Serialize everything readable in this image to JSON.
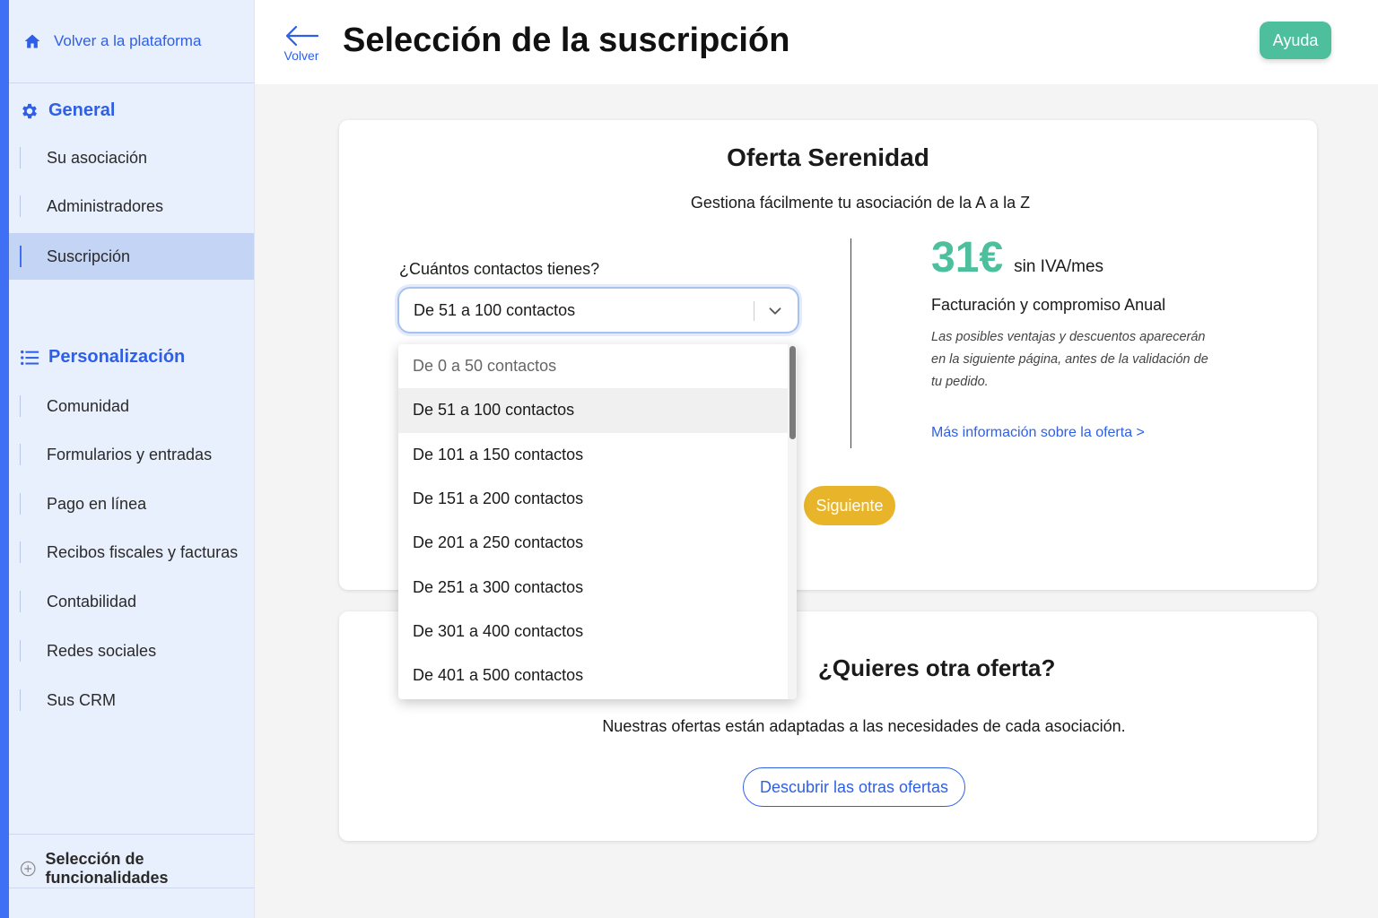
{
  "sidebar": {
    "back_label": "Volver a la plataforma",
    "general_label": "General",
    "general_items": [
      "Su asociación",
      "Administradores",
      "Suscripción"
    ],
    "personalizacion_label": "Personalización",
    "personalizacion_items": [
      "Comunidad",
      "Formularios y entradas",
      "Pago en línea",
      "Recibos fiscales y facturas",
      "Contabilidad",
      "Redes sociales",
      "Sus CRM"
    ],
    "bottom_label": "Selección de funcionalidades",
    "active_item": "Suscripción"
  },
  "header": {
    "back_label": "Volver",
    "title": "Selección de la suscripción",
    "help_label": "Ayuda"
  },
  "offer": {
    "title": "Oferta Serenidad",
    "subtitle": "Gestiona fácilmente tu asociación de la A a la Z",
    "question": "¿Cuántos contactos tienes?",
    "selected_value": "De 51 a 100 contactos",
    "price": "31€",
    "price_unit": "sin IVA/mes",
    "billing": "Facturación y compromiso Anual",
    "note": "Las posibles ventajas y descuentos aparecerán en la siguiente página, antes de la validación de tu pedido.",
    "more_link": "Más información sobre la oferta >",
    "next_label": "Siguiente"
  },
  "dropdown": {
    "options": [
      "De 0 a 50 contactos",
      "De 51 a 100 contactos",
      "De 101 a 150 contactos",
      "De 151 a 200 contactos",
      "De 201 a 250 contactos",
      "De 251 a 300 contactos",
      "De 301 a 400 contactos",
      "De 401 a 500 contactos"
    ]
  },
  "other": {
    "title": "¿Quieres otra oferta?",
    "subtitle": "Nuestras ofertas están adaptadas a las necesidades de cada asociación.",
    "button_label": "Descubrir las otras ofertas"
  },
  "colors": {
    "accent_blue": "#2e5fe6",
    "green": "#4dbf9c",
    "yellow": "#e8b42a",
    "sidebar_bg": "#e8effd"
  },
  "icons": [
    "home-icon",
    "gear-icon",
    "list-icon",
    "plus-circle-icon",
    "arrow-left-icon",
    "chevron-down-icon"
  ]
}
